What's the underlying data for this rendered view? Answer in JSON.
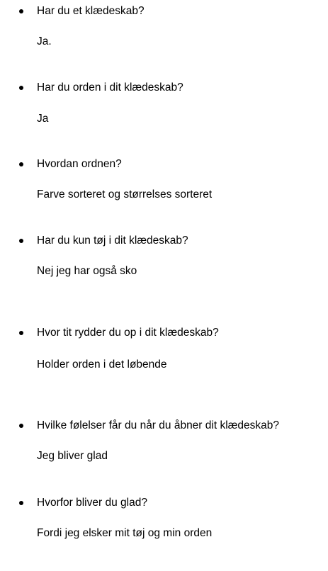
{
  "items": [
    {
      "question": "Har du et klædeskab?",
      "answer": "Ja."
    },
    {
      "question": "Har du orden i dit klædeskab?",
      "answer": "Ja"
    },
    {
      "question": "Hvordan ordnen?",
      "answer": "Farve sorteret og størrelses sorteret"
    },
    {
      "question": "Har du kun tøj i dit klædeskab?",
      "answer": "Nej jeg har også sko"
    },
    {
      "question": "Hvor tit rydder du op i dit klædeskab?",
      "answer": "Holder orden i det løbende"
    },
    {
      "question": "Hvilke følelser får du når du åbner dit klædeskab?",
      "answer": "Jeg bliver glad"
    },
    {
      "question": "Hvorfor bliver du glad?",
      "answer": "Fordi jeg elsker mit tøj og min orden"
    }
  ]
}
